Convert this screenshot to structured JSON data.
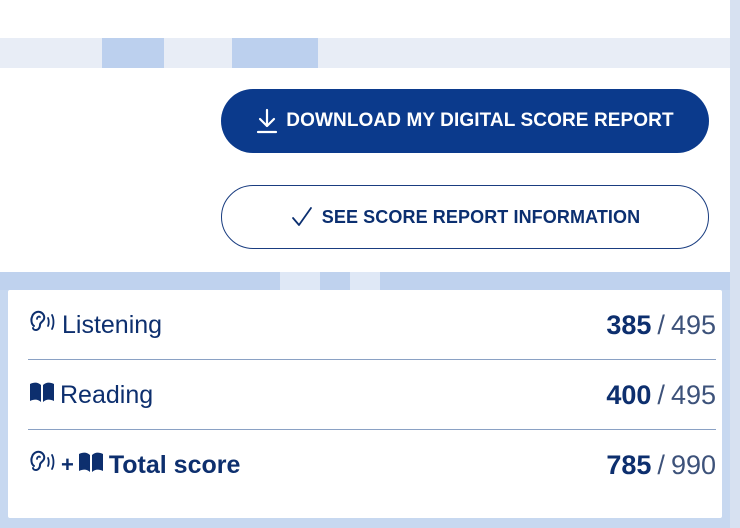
{
  "buttons": {
    "download_label": "DOWNLOAD MY DIGITAL SCORE REPORT",
    "info_label": "SEE SCORE REPORT INFORMATION"
  },
  "scores": [
    {
      "label": "Listening",
      "value": "385",
      "max": "495",
      "icon": "ear-icon"
    },
    {
      "label": "Reading",
      "value": "400",
      "max": "495",
      "icon": "book-icon"
    },
    {
      "label": "Total score",
      "value": "785",
      "max": "990",
      "icon": "ear-plus-book-icon"
    }
  ],
  "separator": "/",
  "plus": "+",
  "colors": {
    "primary": "#0b3a8c",
    "text": "#0d2f6e",
    "background": "#e9eef7",
    "accent_band": "#bcd0ee"
  }
}
